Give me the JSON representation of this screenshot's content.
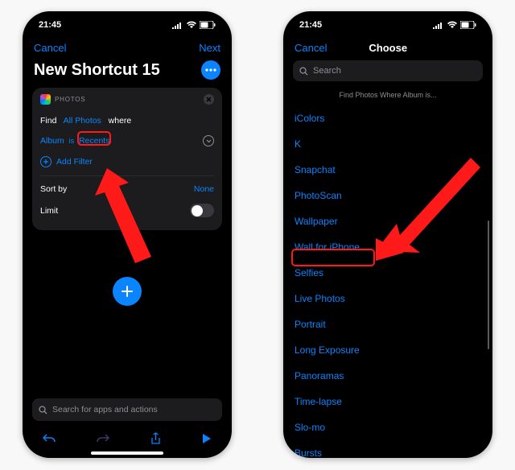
{
  "status": {
    "time": "21:45"
  },
  "colors": {
    "accent": "#0a84ff",
    "callout": "#ff1a1a"
  },
  "left": {
    "nav": {
      "cancel": "Cancel",
      "next": "Next"
    },
    "title": "New Shortcut 15",
    "card": {
      "app_name": "PHOTOS",
      "find_label": "Find",
      "find_token": "All Photos",
      "where_label": "where",
      "album_label": "Album",
      "is_label": "is",
      "recents_token": "Recents",
      "add_filter": "Add Filter",
      "sort_label": "Sort by",
      "sort_value": "None",
      "limit_label": "Limit"
    },
    "bottom_search_placeholder": "Search for apps and actions"
  },
  "right": {
    "nav": {
      "cancel": "Cancel",
      "title": "Choose"
    },
    "search_placeholder": "Search",
    "hint": "Find Photos Where Album is...",
    "albums": [
      "iColors",
      "K",
      "Snapchat",
      "PhotoScan",
      "Wallpaper",
      "Wall for iPhone",
      "Selfies",
      "Live Photos",
      "Portrait",
      "Long Exposure",
      "Panoramas",
      "Time-lapse",
      "Slo-mo",
      "Bursts"
    ],
    "highlight_index": 5
  }
}
